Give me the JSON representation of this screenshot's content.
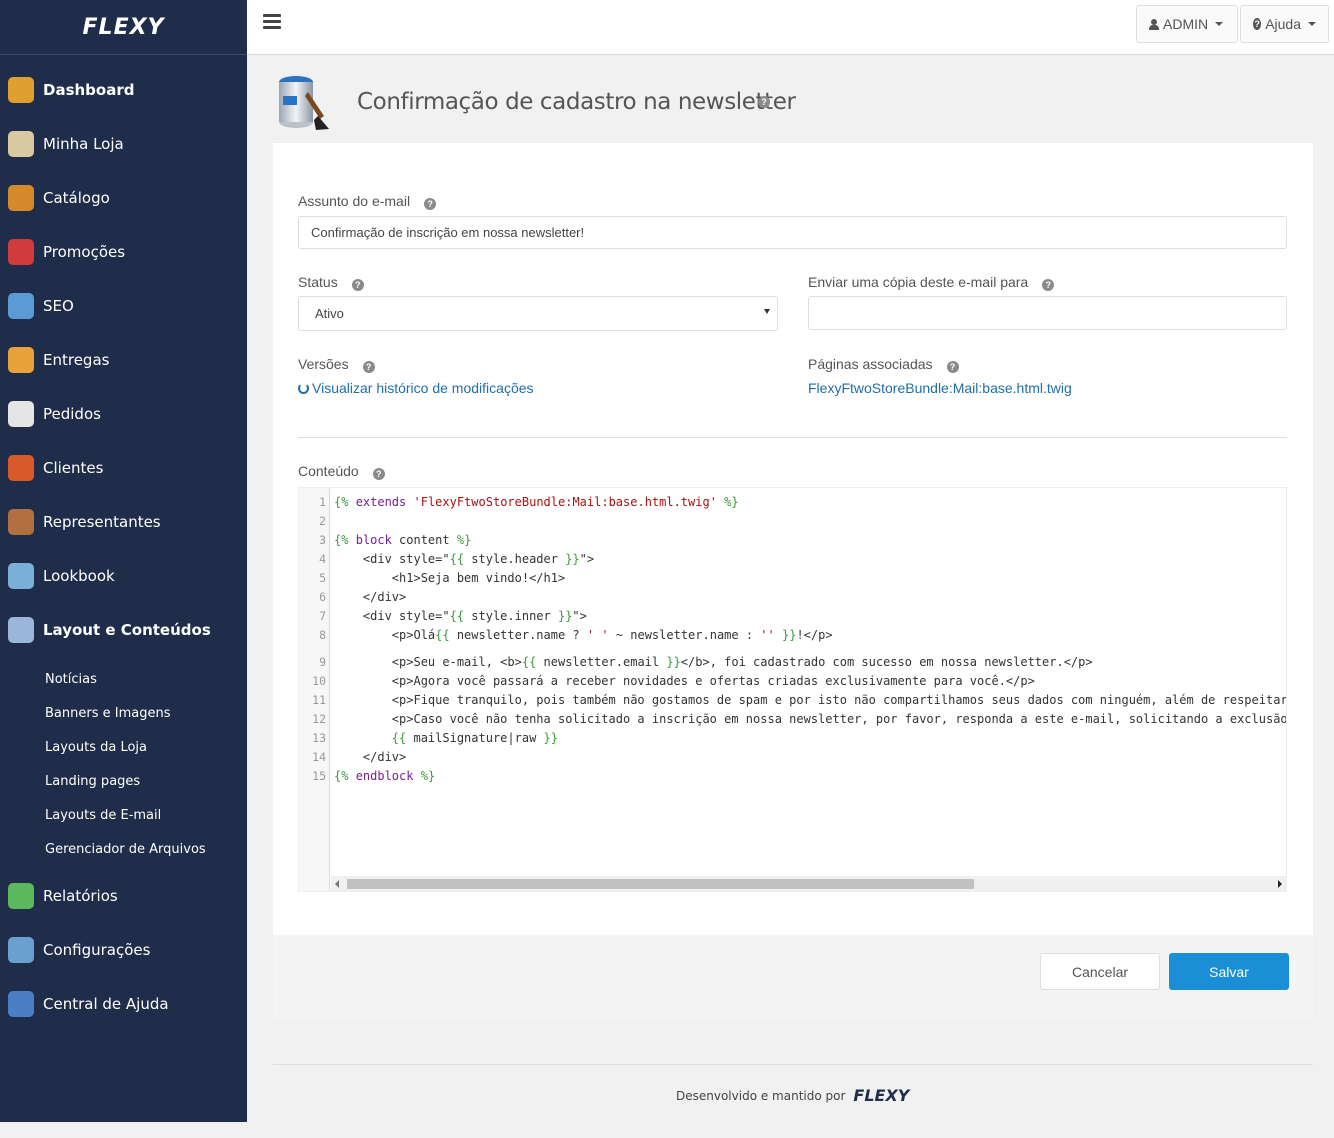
{
  "brand": {
    "logo_text": "FLEXY"
  },
  "sidebar": {
    "items": [
      {
        "label": "Dashboard",
        "icon": "dashboard-icon"
      },
      {
        "label": "Minha Loja",
        "icon": "store-icon"
      },
      {
        "label": "Catálogo",
        "icon": "catalog-box-icon"
      },
      {
        "label": "Promoções",
        "icon": "percent-icon"
      },
      {
        "label": "SEO",
        "icon": "seo-icon"
      },
      {
        "label": "Entregas",
        "icon": "truck-icon"
      },
      {
        "label": "Pedidos",
        "icon": "orders-icon"
      },
      {
        "label": "Clientes",
        "icon": "clients-icon"
      },
      {
        "label": "Representantes",
        "icon": "representative-icon"
      },
      {
        "label": "Lookbook",
        "icon": "image-icon"
      },
      {
        "label": "Layout e Conteúdos",
        "icon": "paint-bucket-icon"
      },
      {
        "label": "Relatórios",
        "icon": "reports-icon"
      },
      {
        "label": "Configurações",
        "icon": "settings-icon"
      },
      {
        "label": "Central de Ajuda",
        "icon": "help-center-icon"
      }
    ],
    "subitems": [
      "Notícias",
      "Banners e Imagens",
      "Layouts da Loja",
      "Landing pages",
      "Layouts de E-mail",
      "Gerenciador de Arquivos"
    ]
  },
  "topbar": {
    "user_label": "ADMIN",
    "help_label": "Ajuda"
  },
  "page": {
    "title": "Confirmação de cadastro na newsletter"
  },
  "form": {
    "subject_label": "Assunto do e-mail",
    "subject_value": "Confirmação de inscrição em nossa newsletter!",
    "status_label": "Status",
    "status_value": "Ativo",
    "copy_label": "Enviar uma cópia deste e-mail para",
    "copy_value": "",
    "versions_label": "Versões",
    "versions_link": "Visualizar histórico de modificações",
    "pages_label": "Páginas associadas",
    "pages_link": "FlexyFtwoStoreBundle:Mail:base.html.twig",
    "content_label": "Conteúdo"
  },
  "editor": {
    "lines": [
      {
        "n": "1",
        "html": "<span class=\"tw\">{% </span><span class=\"kw\">extends</span> <span class=\"st\">'FlexyFtwoStoreBundle:Mail:base.html.twig'</span><span class=\"tw\"> %}</span>"
      },
      {
        "n": "2",
        "html": ""
      },
      {
        "n": "3",
        "html": "<span class=\"tw\">{% </span><span class=\"kw\">block</span> content <span class=\"tw\">%}</span>"
      },
      {
        "n": "4",
        "html": "    &lt;div style=\"<span class=\"tw\">{{</span> style.header <span class=\"tw\">}}</span>\"&gt;"
      },
      {
        "n": "5",
        "html": "        &lt;h1&gt;Seja bem vindo!&lt;/h1&gt;"
      },
      {
        "n": "6",
        "html": "    &lt;/div&gt;"
      },
      {
        "n": "7",
        "html": "    &lt;div style=\"<span class=\"tw\">{{</span> style.inner <span class=\"tw\">}}</span>\"&gt;"
      },
      {
        "n": "8",
        "html": "        &lt;p&gt;Olá<span class=\"tw\">{{</span> newsletter.name ? <span class=\"st\">' '</span> ~ newsletter.name : <span class=\"st\">''</span> <span class=\"tw\">}}</span>!&lt;/p&gt;"
      },
      {
        "n": "9",
        "html": "        &lt;p&gt;Seu e-mail, &lt;b&gt;<span class=\"tw\">{{</span> newsletter.email <span class=\"tw\">}}</span>&lt;/b&gt;, foi cadastrado com sucesso em nossa newsletter.&lt;/p&gt;"
      },
      {
        "n": "10",
        "html": "        &lt;p&gt;Agora você passará a receber novidades e ofertas criadas exclusivamente para você.&lt;/p&gt;"
      },
      {
        "n": "11",
        "html": "        &lt;p&gt;Fique tranquilo, pois também não gostamos de spam e por isto não compartilhamos seus dados com ninguém, além de respeitarmo"
      },
      {
        "n": "12",
        "html": "        &lt;p&gt;Caso você não tenha solicitado a inscrição em nossa newsletter, por favor, responda a este e-mail, solicitando a exclusão d"
      },
      {
        "n": "13",
        "html": "        <span class=\"tw\">{{</span> mailSignature|raw <span class=\"tw\">}}</span>"
      },
      {
        "n": "14",
        "html": "    &lt;/div&gt;"
      },
      {
        "n": "15",
        "html": "<span class=\"tw\">{% </span><span class=\"kw\">endblock</span> <span class=\"tw\">%}</span>"
      }
    ]
  },
  "actions": {
    "cancel_label": "Cancelar",
    "save_label": "Salvar"
  },
  "footer": {
    "text": "Desenvolvido e mantido por",
    "logo_text": "FLEXY"
  },
  "colors": {
    "sidebar_bg": "#1f2d4a",
    "primary_button": "#1a8fd6",
    "link": "#1e6fa8"
  }
}
